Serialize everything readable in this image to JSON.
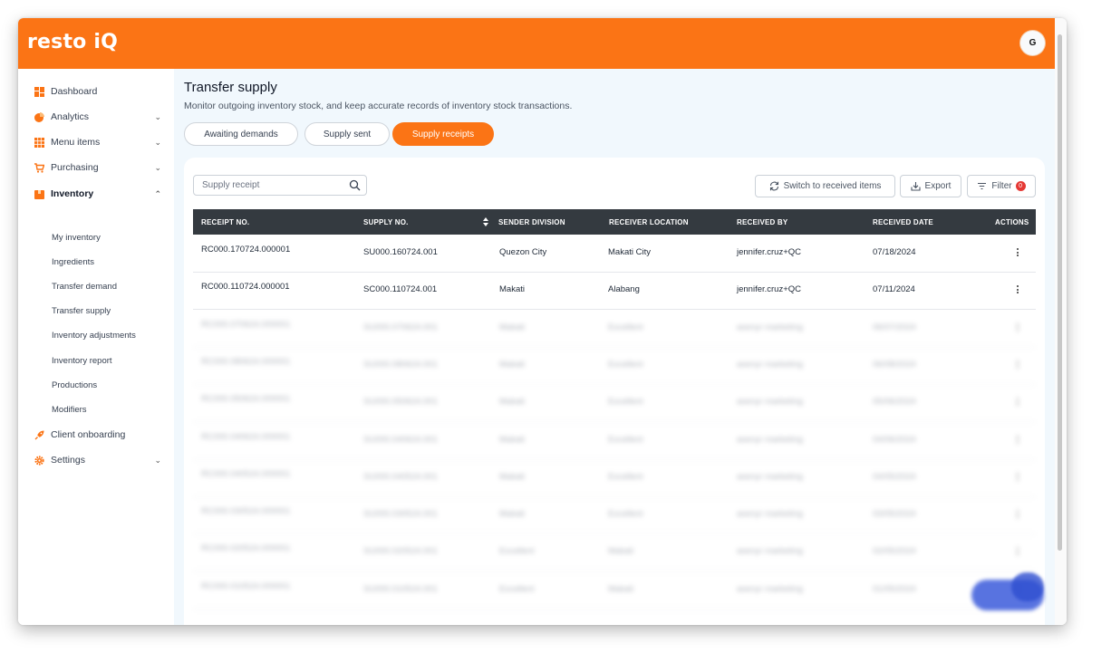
{
  "app": {
    "logo": "resto iQ",
    "avatar_initial": "G",
    "brand_color": "#fb7415"
  },
  "sidebar": {
    "items": [
      {
        "label": "Dashboard",
        "icon": "dashboard-icon",
        "chevron": ""
      },
      {
        "label": "Analytics",
        "icon": "pie-chart-icon",
        "chevron": "down"
      },
      {
        "label": "Menu items",
        "icon": "grid-icon",
        "chevron": "down"
      },
      {
        "label": "Purchasing",
        "icon": "cart-icon",
        "chevron": "down"
      },
      {
        "label": "Inventory",
        "icon": "box-icon",
        "chevron": "up",
        "active": true
      },
      {
        "label": "Client onboarding",
        "icon": "rocket-icon",
        "chevron": ""
      },
      {
        "label": "Settings",
        "icon": "gear-icon",
        "chevron": "down"
      }
    ],
    "inventory_sub": [
      "My inventory",
      "Ingredients",
      "Transfer demand",
      "Transfer supply",
      "Inventory adjustments",
      "Inventory report",
      "Productions",
      "Modifiers"
    ]
  },
  "page": {
    "title": "Transfer supply",
    "subtitle": "Monitor outgoing inventory stock, and keep accurate records of inventory stock transactions."
  },
  "tabs": [
    {
      "label": "Awaiting demands",
      "active": false
    },
    {
      "label": "Supply sent",
      "active": false
    },
    {
      "label": "Supply receipts",
      "active": true
    }
  ],
  "toolbar": {
    "search_placeholder": "Supply receipt",
    "switch_label": "Switch to received items",
    "export_label": "Export",
    "filter_label": "Filter",
    "filter_count": "0"
  },
  "table": {
    "headers": [
      "RECEIPT NO.",
      "SUPPLY NO.",
      "SENDER DIVISION",
      "RECEIVER LOCATION",
      "RECEIVED BY",
      "RECEIVED DATE",
      "ACTIONS"
    ],
    "rows": [
      [
        "RC000.170724.000001",
        "SU000.160724.001",
        "Quezon City",
        "Makati City",
        "jennifer.cruz+QC",
        "07/18/2024"
      ],
      [
        "RC000.110724.000001",
        "SC000.110724.001",
        "Makati",
        "Alabang",
        "jennifer.cruz+QC",
        "07/11/2024"
      ],
      [
        "RC000.070624.000001",
        "SU000.070624.001",
        "Makati",
        "Excellent",
        "asenyr marketing",
        "06/07/2024"
      ],
      [
        "RC000.080624.000001",
        "SU000.080624.001",
        "Makati",
        "Excellent",
        "asenyr marketing",
        "06/08/2024"
      ],
      [
        "RC000.050624.000001",
        "SU000.050624.001",
        "Makati",
        "Excellent",
        "asenyr marketing",
        "05/06/2024"
      ],
      [
        "RC000.040624.000001",
        "SU000.040624.001",
        "Makati",
        "Excellent",
        "asenyr marketing",
        "04/06/2024"
      ],
      [
        "RC000.040524.000001",
        "SU000.040524.001",
        "Makati",
        "Excellent",
        "asenyr marketing",
        "04/05/2024"
      ],
      [
        "RC000.030524.000001",
        "SU000.030524.001",
        "Makati",
        "Excellent",
        "asenyr marketing",
        "03/05/2024"
      ],
      [
        "RC000.020524.000001",
        "SU000.020524.001",
        "Excellent",
        "Makati",
        "asenyr marketing",
        "02/05/2024"
      ],
      [
        "RC000.010524.000001",
        "SU000.010524.001",
        "Excellent",
        "Makati",
        "asenyr marketing",
        "01/05/2024"
      ]
    ],
    "blurred_from_row": 2
  }
}
